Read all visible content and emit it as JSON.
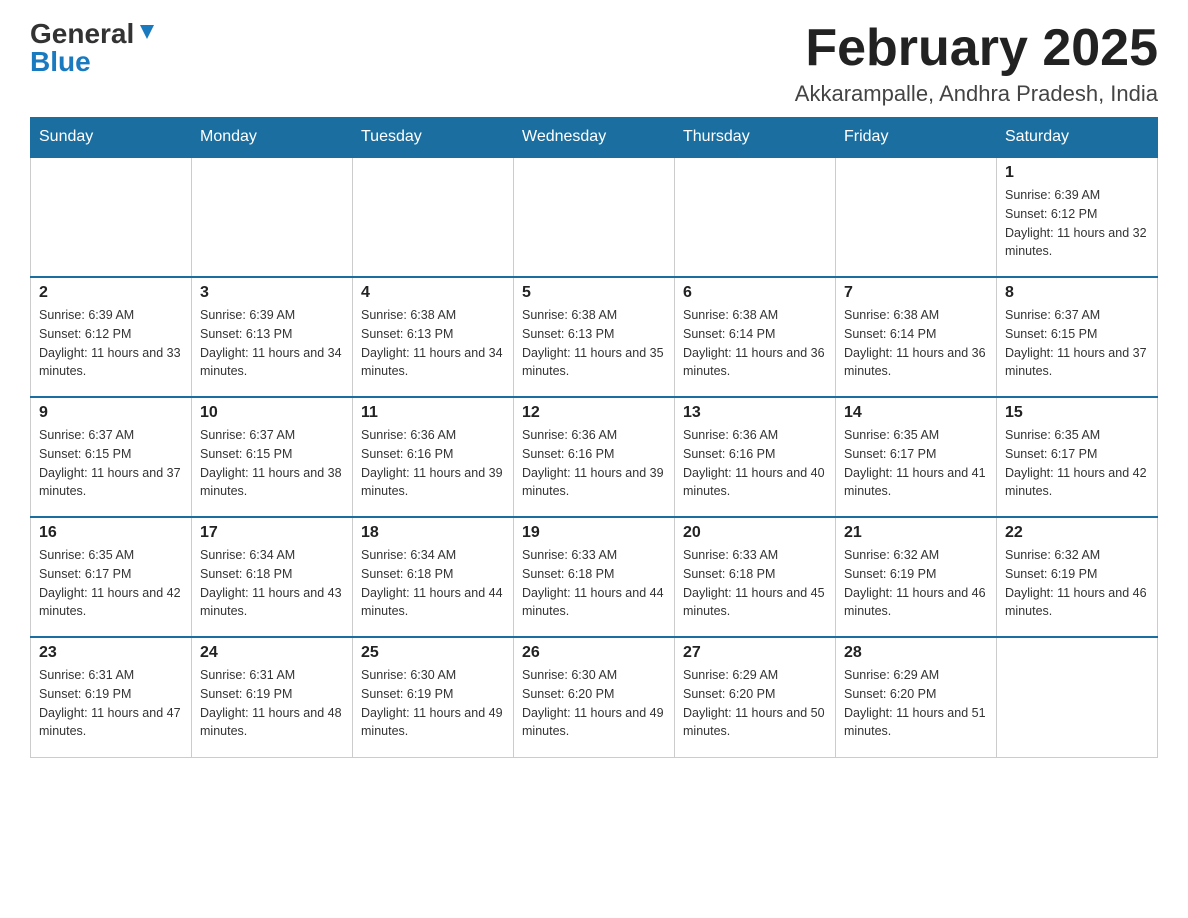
{
  "header": {
    "logo_general": "General",
    "logo_blue": "Blue",
    "title": "February 2025",
    "location": "Akkarampalle, Andhra Pradesh, India"
  },
  "days_of_week": [
    "Sunday",
    "Monday",
    "Tuesday",
    "Wednesday",
    "Thursday",
    "Friday",
    "Saturday"
  ],
  "weeks": [
    [
      {
        "day": "",
        "info": ""
      },
      {
        "day": "",
        "info": ""
      },
      {
        "day": "",
        "info": ""
      },
      {
        "day": "",
        "info": ""
      },
      {
        "day": "",
        "info": ""
      },
      {
        "day": "",
        "info": ""
      },
      {
        "day": "1",
        "info": "Sunrise: 6:39 AM\nSunset: 6:12 PM\nDaylight: 11 hours and 32 minutes."
      }
    ],
    [
      {
        "day": "2",
        "info": "Sunrise: 6:39 AM\nSunset: 6:12 PM\nDaylight: 11 hours and 33 minutes."
      },
      {
        "day": "3",
        "info": "Sunrise: 6:39 AM\nSunset: 6:13 PM\nDaylight: 11 hours and 34 minutes."
      },
      {
        "day": "4",
        "info": "Sunrise: 6:38 AM\nSunset: 6:13 PM\nDaylight: 11 hours and 34 minutes."
      },
      {
        "day": "5",
        "info": "Sunrise: 6:38 AM\nSunset: 6:13 PM\nDaylight: 11 hours and 35 minutes."
      },
      {
        "day": "6",
        "info": "Sunrise: 6:38 AM\nSunset: 6:14 PM\nDaylight: 11 hours and 36 minutes."
      },
      {
        "day": "7",
        "info": "Sunrise: 6:38 AM\nSunset: 6:14 PM\nDaylight: 11 hours and 36 minutes."
      },
      {
        "day": "8",
        "info": "Sunrise: 6:37 AM\nSunset: 6:15 PM\nDaylight: 11 hours and 37 minutes."
      }
    ],
    [
      {
        "day": "9",
        "info": "Sunrise: 6:37 AM\nSunset: 6:15 PM\nDaylight: 11 hours and 37 minutes."
      },
      {
        "day": "10",
        "info": "Sunrise: 6:37 AM\nSunset: 6:15 PM\nDaylight: 11 hours and 38 minutes."
      },
      {
        "day": "11",
        "info": "Sunrise: 6:36 AM\nSunset: 6:16 PM\nDaylight: 11 hours and 39 minutes."
      },
      {
        "day": "12",
        "info": "Sunrise: 6:36 AM\nSunset: 6:16 PM\nDaylight: 11 hours and 39 minutes."
      },
      {
        "day": "13",
        "info": "Sunrise: 6:36 AM\nSunset: 6:16 PM\nDaylight: 11 hours and 40 minutes."
      },
      {
        "day": "14",
        "info": "Sunrise: 6:35 AM\nSunset: 6:17 PM\nDaylight: 11 hours and 41 minutes."
      },
      {
        "day": "15",
        "info": "Sunrise: 6:35 AM\nSunset: 6:17 PM\nDaylight: 11 hours and 42 minutes."
      }
    ],
    [
      {
        "day": "16",
        "info": "Sunrise: 6:35 AM\nSunset: 6:17 PM\nDaylight: 11 hours and 42 minutes."
      },
      {
        "day": "17",
        "info": "Sunrise: 6:34 AM\nSunset: 6:18 PM\nDaylight: 11 hours and 43 minutes."
      },
      {
        "day": "18",
        "info": "Sunrise: 6:34 AM\nSunset: 6:18 PM\nDaylight: 11 hours and 44 minutes."
      },
      {
        "day": "19",
        "info": "Sunrise: 6:33 AM\nSunset: 6:18 PM\nDaylight: 11 hours and 44 minutes."
      },
      {
        "day": "20",
        "info": "Sunrise: 6:33 AM\nSunset: 6:18 PM\nDaylight: 11 hours and 45 minutes."
      },
      {
        "day": "21",
        "info": "Sunrise: 6:32 AM\nSunset: 6:19 PM\nDaylight: 11 hours and 46 minutes."
      },
      {
        "day": "22",
        "info": "Sunrise: 6:32 AM\nSunset: 6:19 PM\nDaylight: 11 hours and 46 minutes."
      }
    ],
    [
      {
        "day": "23",
        "info": "Sunrise: 6:31 AM\nSunset: 6:19 PM\nDaylight: 11 hours and 47 minutes."
      },
      {
        "day": "24",
        "info": "Sunrise: 6:31 AM\nSunset: 6:19 PM\nDaylight: 11 hours and 48 minutes."
      },
      {
        "day": "25",
        "info": "Sunrise: 6:30 AM\nSunset: 6:19 PM\nDaylight: 11 hours and 49 minutes."
      },
      {
        "day": "26",
        "info": "Sunrise: 6:30 AM\nSunset: 6:20 PM\nDaylight: 11 hours and 49 minutes."
      },
      {
        "day": "27",
        "info": "Sunrise: 6:29 AM\nSunset: 6:20 PM\nDaylight: 11 hours and 50 minutes."
      },
      {
        "day": "28",
        "info": "Sunrise: 6:29 AM\nSunset: 6:20 PM\nDaylight: 11 hours and 51 minutes."
      },
      {
        "day": "",
        "info": ""
      }
    ]
  ]
}
